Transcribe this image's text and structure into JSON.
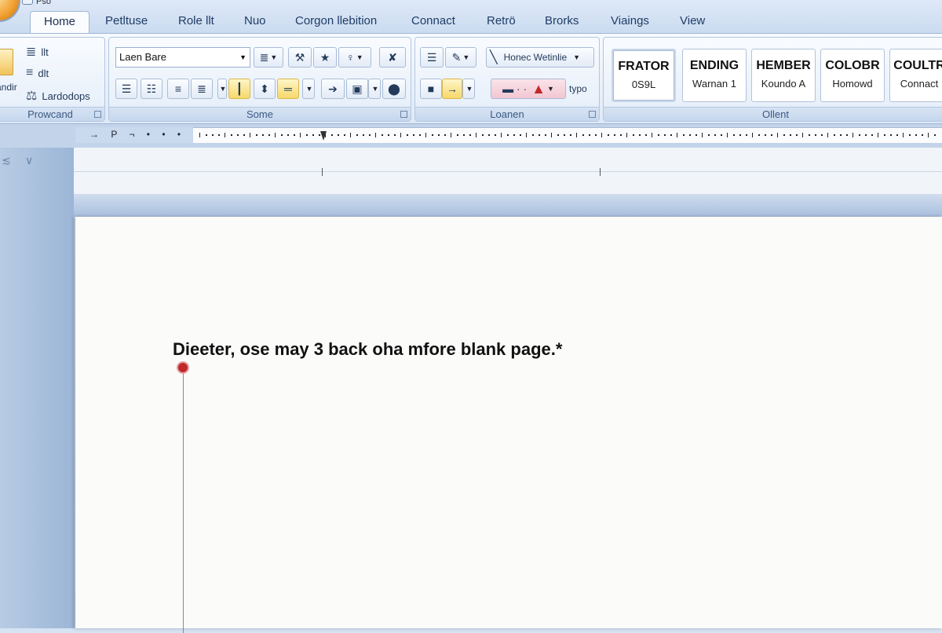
{
  "window": {
    "title_a": "Pso",
    "title_b": ""
  },
  "tabs": [
    {
      "label": "Home",
      "active": true
    },
    {
      "label": "Petltuse"
    },
    {
      "label": "Role llt"
    },
    {
      "label": "Nuo"
    },
    {
      "label": "Corgon llebition"
    },
    {
      "label": "Connact"
    },
    {
      "label": "Retrö"
    },
    {
      "label": "Brorks"
    },
    {
      "label": "Viaings"
    },
    {
      "label": "View"
    }
  ],
  "ribbon": {
    "clipboard": {
      "label": "Prowcand",
      "items": [
        "llt",
        "dlt",
        "Lardodops"
      ],
      "partial_label": "andir"
    },
    "font": {
      "label": "Some",
      "font_name": "Laen Bare"
    },
    "paragraph": {
      "label": "Loanen",
      "highlight_label": "Honec Wetinlie",
      "type_label": "typo"
    },
    "styles": {
      "label": "Ollent",
      "cards": [
        {
          "name": "FRATOR",
          "sub": "0S9L"
        },
        {
          "name": "ENDING",
          "sub": "Warnan 1"
        },
        {
          "name": "HEMBER",
          "sub": "Koundo A"
        },
        {
          "name": "COLOBR",
          "sub": "Homowd"
        },
        {
          "name": "COULTR",
          "sub": "Connact"
        }
      ]
    }
  },
  "ruler_side": "→ P ¬ • • •",
  "document": {
    "text": "Dieeter, ose may 3 back oha mfore blank page.*"
  },
  "colors": {
    "accent": "#c0292a",
    "ribbon": "#dfe9f6",
    "tab_text": "#1f3d66"
  }
}
